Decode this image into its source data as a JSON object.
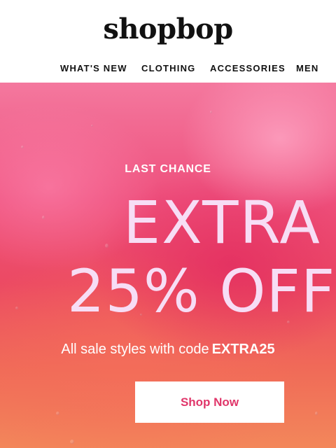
{
  "brand": {
    "logo_text": "shopbop"
  },
  "nav": {
    "items": [
      {
        "label": "WHAT'S NEW"
      },
      {
        "label": "CLOTHING"
      },
      {
        "label": "ACCESSORIES"
      },
      {
        "label": "MEN"
      }
    ]
  },
  "hero": {
    "eyebrow": "LAST CHANCE",
    "headline_line1": "EXTRA",
    "headline_line2": "25% OFF",
    "subline_text": "All sale styles with code",
    "subline_code": "EXTRA25",
    "cta_label": "Shop Now"
  },
  "colors": {
    "accent": "#e0366a",
    "headline": "#f7ddf5",
    "text_dark": "#111111"
  }
}
